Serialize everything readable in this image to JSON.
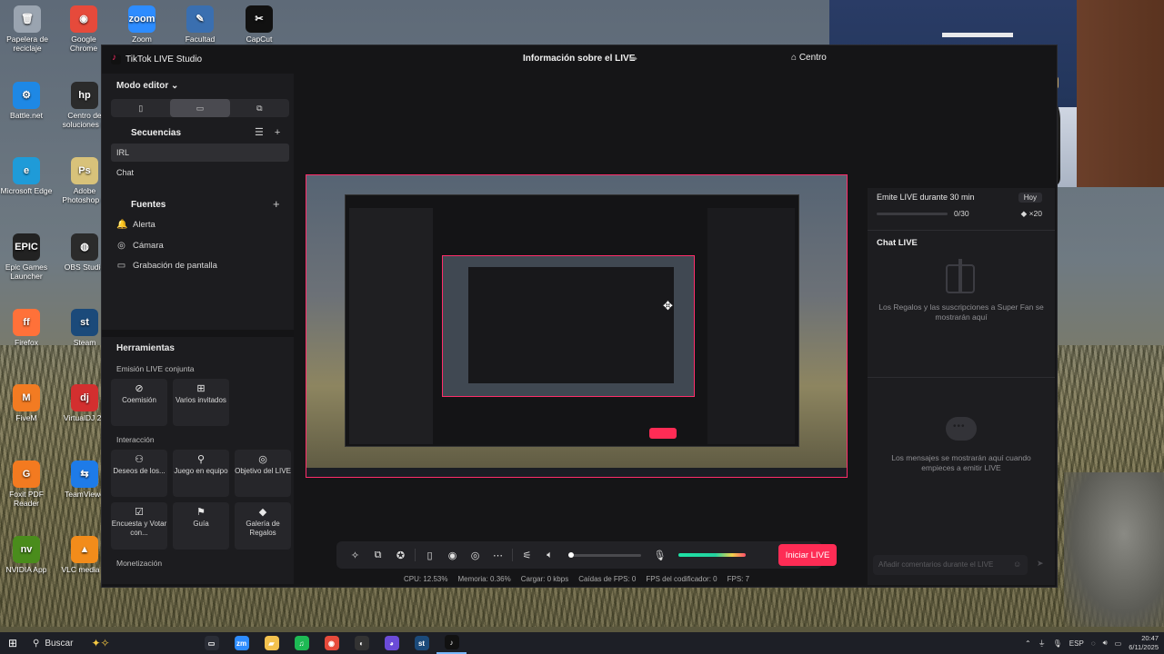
{
  "desktop": {
    "icons_top": [
      {
        "label": "Papelera de reciclaje",
        "abbr": "🗑",
        "color": "#9aa4b0"
      },
      {
        "label": "Google Chrome",
        "abbr": "◉",
        "color": "#e64a3b"
      },
      {
        "label": "Zoom Workplace",
        "abbr": "zoom",
        "color": "#2d8cff"
      },
      {
        "label": "Facultad UNTREF",
        "abbr": "✎",
        "color": "#3a6fb0"
      },
      {
        "label": "CapCut",
        "abbr": "✂",
        "color": "#111111"
      }
    ],
    "icons_left": [
      {
        "label": "Battle.net",
        "abbr": "⚙",
        "color": "#1e88e5"
      },
      {
        "label": "Centro de soluciones H",
        "abbr": "hp",
        "color": "#2b2b2b"
      },
      {
        "label": "Microsoft Edge",
        "abbr": "e",
        "color": "#1f9bd8"
      },
      {
        "label": "Adobe Photoshop C",
        "abbr": "Ps",
        "color": "#d8c27a"
      },
      {
        "label": "Epic Games Launcher",
        "abbr": "EPIC",
        "color": "#222222"
      },
      {
        "label": "OBS Studio",
        "abbr": "◍",
        "color": "#2b2b2b"
      },
      {
        "label": "Firefox",
        "abbr": "ff",
        "color": "#ff7139"
      },
      {
        "label": "Steam",
        "abbr": "st",
        "color": "#1b4a7a"
      },
      {
        "label": "FiveM",
        "abbr": "M",
        "color": "#f27b22"
      },
      {
        "label": "VirtualDJ 20",
        "abbr": "dj",
        "color": "#d32f2f"
      },
      {
        "label": "Foxit PDF Reader",
        "abbr": "G",
        "color": "#f37a20"
      },
      {
        "label": "TeamViewe",
        "abbr": "⇆",
        "color": "#1e7be8"
      },
      {
        "label": "NVIDIA App",
        "abbr": "nv",
        "color": "#4a8c1c"
      },
      {
        "label": "VLC media pl",
        "abbr": "▲",
        "color": "#f28c1b"
      }
    ]
  },
  "studio": {
    "app_title": "TikTok LIVE Studio",
    "center_title": "Información sobre el LIVE",
    "right_link": "Centro",
    "editor_mode": "Modo editor",
    "sequences_title": "Secuencias",
    "sequences": [
      {
        "label": "IRL"
      },
      {
        "label": "Chat"
      }
    ],
    "sources_title": "Fuentes",
    "sources": [
      {
        "label": "Alerta",
        "glyph": "🔔"
      },
      {
        "label": "Cámara",
        "glyph": "◎"
      },
      {
        "label": "Grabación de pantalla",
        "glyph": "▭"
      }
    ],
    "tools_title": "Herramientas",
    "tools_joint_title": "Emisión LIVE conjunta",
    "tools_joint": [
      {
        "label": "Coemisión",
        "glyph": "⊘"
      },
      {
        "label": "Varios invitados",
        "glyph": "⊞"
      }
    ],
    "tools_interaction_title": "Interacción",
    "tools_interaction": [
      {
        "label": "Deseos de los...",
        "glyph": "⚇"
      },
      {
        "label": "Juego en equipo",
        "glyph": "⚲"
      },
      {
        "label": "Objetivo del LIVE",
        "glyph": "◎"
      },
      {
        "label": "Encuesta y Votar con...",
        "glyph": "☑"
      },
      {
        "label": "Guía",
        "glyph": "⚑"
      },
      {
        "label": "Galería de Regalos",
        "glyph": "◆"
      }
    ],
    "tools_monetization_title": "Monetización",
    "start_button": "Iniciar LIVE",
    "stats": {
      "cpu": "CPU: 12.53%",
      "memory": "Memoria: 0.36%",
      "upload": "Cargar: 0 kbps",
      "fps_drop": "Caídas de FPS: 0",
      "encoder_fps": "FPS del codificador: 0",
      "fps": "FPS: 7"
    },
    "volume_level": 0.0,
    "mic_level": 0.82
  },
  "right_panel": {
    "goal_title": "Emite LIVE durante 30 min",
    "goal_period": "Hoy",
    "goal_progress": "0/30",
    "goal_reward": "×20",
    "chat_title": "Chat LIVE",
    "gifts_empty": "Los Regalos y las suscripciones a Super Fan se mostrarán aquí",
    "messages_empty": "Los mensajes se mostrarán aquí cuando empieces a emitir LIVE",
    "comment_placeholder": "Añadir comentarios durante el LIVE"
  },
  "taskbar": {
    "search_label": "Buscar",
    "apps": [
      {
        "name": "task-view",
        "abbr": "▭",
        "color": "#2a2d36"
      },
      {
        "name": "zoom",
        "abbr": "zm",
        "color": "#2d8cff"
      },
      {
        "name": "file-explorer",
        "abbr": "▰",
        "color": "#f2c14e"
      },
      {
        "name": "spotify",
        "abbr": "♫",
        "color": "#1db954"
      },
      {
        "name": "chrome",
        "abbr": "◉",
        "color": "#e64a3b"
      },
      {
        "name": "app-circle",
        "abbr": "◐",
        "color": "#333"
      },
      {
        "name": "app-purple",
        "abbr": "◕",
        "color": "#6b4bd8"
      },
      {
        "name": "steam",
        "abbr": "st",
        "color": "#1b4a7a"
      },
      {
        "name": "tiktok-live",
        "abbr": "♪",
        "color": "#111"
      }
    ],
    "language": "ESP",
    "time": "20:47",
    "date": "6/11/2025"
  },
  "colors": {
    "accent": "#fe2c55",
    "panel": "#1c1c1f",
    "window": "#151517"
  }
}
